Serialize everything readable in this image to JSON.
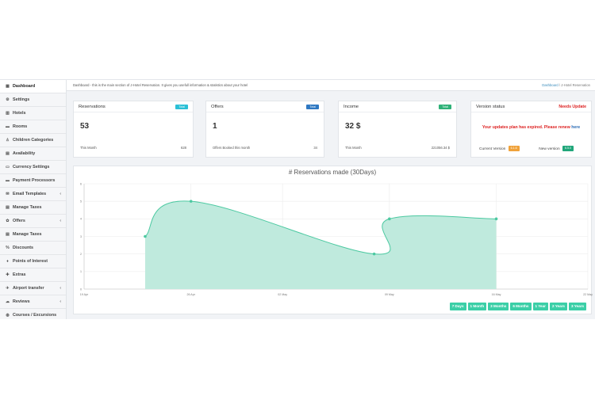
{
  "sidebar": {
    "items": [
      {
        "label": "Dashboard",
        "icon": "dashboard-icon",
        "glyph": "▦",
        "arrow": ""
      },
      {
        "label": "Settings",
        "icon": "gear-icon",
        "glyph": "⚙",
        "arrow": ""
      },
      {
        "label": "Hotels",
        "icon": "building-icon",
        "glyph": "▥",
        "arrow": ""
      },
      {
        "label": "Rooms",
        "icon": "bed-icon",
        "glyph": "▬",
        "arrow": ""
      },
      {
        "label": "Children Categories",
        "icon": "child-icon",
        "glyph": "♙",
        "arrow": ""
      },
      {
        "label": "Availability",
        "icon": "calendar-icon",
        "glyph": "▤",
        "arrow": ""
      },
      {
        "label": "Currency Settings",
        "icon": "money-icon",
        "glyph": "▭",
        "arrow": ""
      },
      {
        "label": "Payment Processors",
        "icon": "credit-card-icon",
        "glyph": "▬",
        "arrow": ""
      },
      {
        "label": "Email Templates",
        "icon": "envelope-icon",
        "glyph": "✉",
        "arrow": "‹"
      },
      {
        "label": "Manage Taxes",
        "icon": "receipt-icon",
        "glyph": "▤",
        "arrow": ""
      },
      {
        "label": "Offers",
        "icon": "gift-icon",
        "glyph": "✿",
        "arrow": "‹"
      },
      {
        "label": "Manage Taxes",
        "icon": "receipt-icon",
        "glyph": "▤",
        "arrow": ""
      },
      {
        "label": "Discounts",
        "icon": "percent-icon",
        "glyph": "%",
        "arrow": ""
      },
      {
        "label": "Points of Interest",
        "icon": "map-marker-icon",
        "glyph": "♦",
        "arrow": ""
      },
      {
        "label": "Extras",
        "icon": "plus-icon",
        "glyph": "✚",
        "arrow": ""
      },
      {
        "label": "Airport transfer",
        "icon": "plane-icon",
        "glyph": "✈",
        "arrow": "‹"
      },
      {
        "label": "Reviews",
        "icon": "comments-icon",
        "glyph": "☁",
        "arrow": "‹"
      },
      {
        "label": "Courses / Excursions",
        "icon": "globe-icon",
        "glyph": "◍",
        "arrow": ""
      }
    ]
  },
  "topbar": {
    "description": "Dashboard - this is the main section of J-Hotel Reservation. It gives you usefull information & statistics about your hotel",
    "breadcrumb_link": "Dashboard",
    "breadcrumb_sep": "/",
    "breadcrumb_current": "J-Hotel Reservation"
  },
  "cards": {
    "reservations": {
      "title": "Reservations",
      "badge": "Total",
      "value": "53",
      "foot_label": "This Month",
      "foot_value": "628"
    },
    "offers": {
      "title": "Offers",
      "badge": "Total",
      "value": "1",
      "foot_label": "Offers Booked this month",
      "foot_value": "34"
    },
    "income": {
      "title": "Income",
      "badge": "Total",
      "value": "32 $",
      "foot_label": "This Month",
      "foot_value": "221056.34 $"
    },
    "version": {
      "title": "Version status",
      "status": "Needs Update",
      "message": "Your updates plan has expired. Please renew",
      "link": "here",
      "current_label": "Current Version",
      "current_value": "6.1.6",
      "new_label": "New version",
      "new_value": "6.5.0"
    }
  },
  "colors": {
    "teal_badge": "#2bc0d6",
    "blue_badge": "#2e78c2",
    "green_badge": "#2fb178",
    "orange_tag": "#f0a23a",
    "green_tag": "#20a67a",
    "chart_fill": "#bfeadd",
    "chart_line": "#4cc9a1",
    "range_button": "#3bcfa7"
  },
  "chart_data": {
    "type": "area",
    "title": "# Reservations made (30Days)",
    "x_ticks": [
      "19 Apr",
      "26 Apr",
      "02 May",
      "09 May",
      "16 May",
      "22 May"
    ],
    "x": [
      "2020-04-23",
      "2020-04-26",
      "2020-05-08",
      "2020-05-09",
      "2020-05-16"
    ],
    "series": [
      {
        "values": [
          3,
          5,
          2,
          4,
          4
        ]
      }
    ],
    "ylim": [
      0,
      6
    ],
    "y_ticks": [
      0,
      1,
      2,
      3,
      4,
      5,
      6
    ],
    "grid": true
  },
  "ranges": [
    "7 Days",
    "1 Month",
    "3 Months",
    "6 Months",
    "1 Year",
    "2 Years",
    "3 Years"
  ]
}
